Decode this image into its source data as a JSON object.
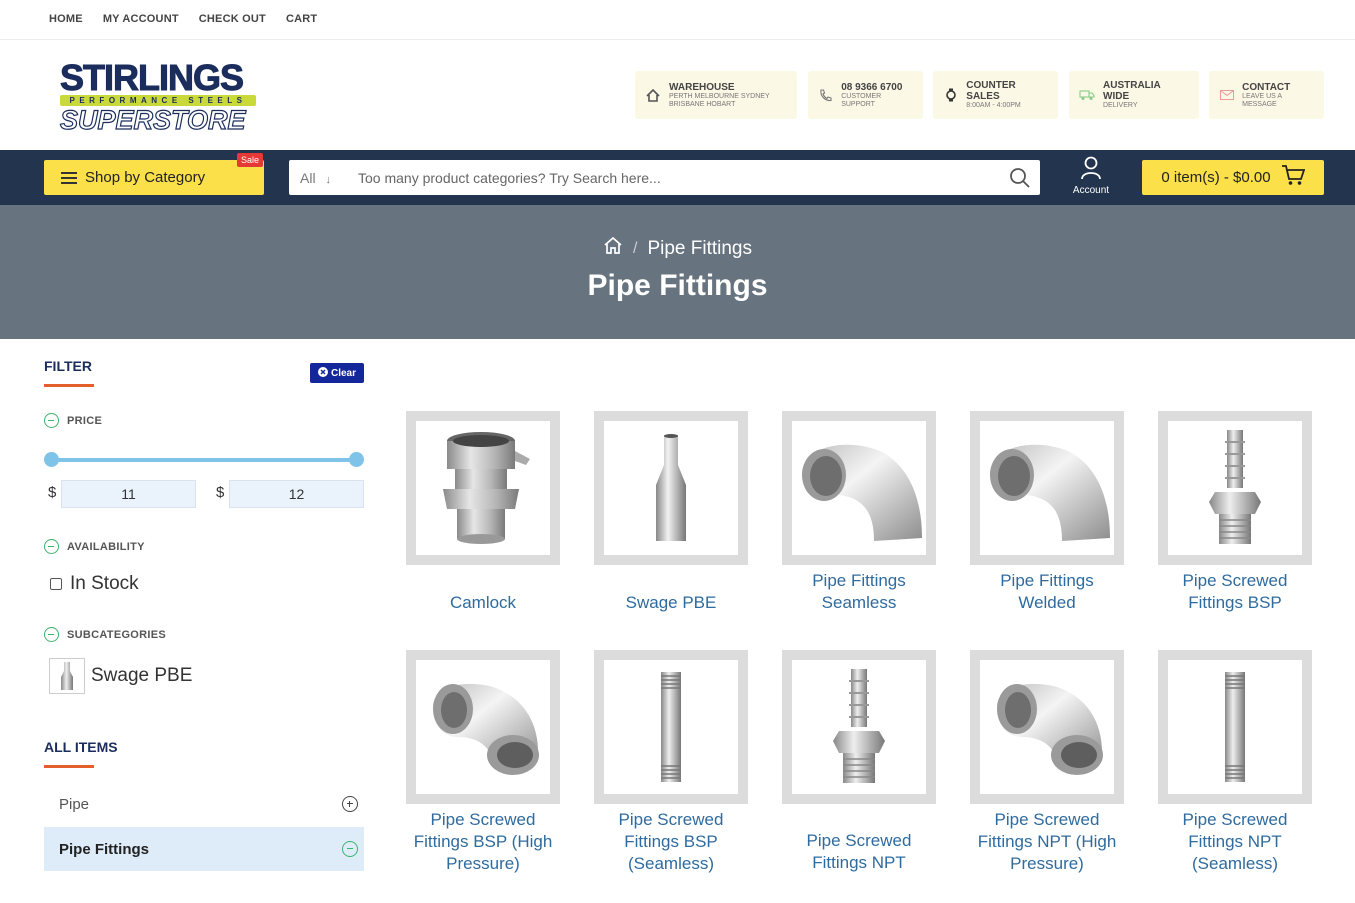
{
  "topnav": [
    "HOME",
    "MY ACCOUNT",
    "CHECK OUT",
    "CART"
  ],
  "logo": {
    "line1": "STIRLINGS",
    "line2": "PERFORMANCE STEELS",
    "line3": "SUPERSTORE"
  },
  "info": [
    {
      "title": "WAREHOUSE",
      "sub1": "PERTH MELBOURNE SYDNEY",
      "sub2": "BRISBANE HOBART",
      "icon": "home-icon"
    },
    {
      "title": "08 9366 6700",
      "sub1": "CUSTOMER SUPPORT",
      "sub2": "",
      "icon": "phone-icon"
    },
    {
      "title": "COUNTER SALES",
      "sub1": "8:00AM - 4:00PM",
      "sub2": "",
      "icon": "clock-icon"
    },
    {
      "title": "AUSTRALIA WIDE",
      "sub1": "DELIVERY",
      "sub2": "",
      "icon": "truck-icon"
    },
    {
      "title": "CONTACT",
      "sub1": "LEAVE US A MESSAGE",
      "sub2": "",
      "icon": "mail-icon"
    }
  ],
  "nav": {
    "shop_label": "Shop by Category",
    "sale_badge": "Sale",
    "search_scope": "All",
    "search_placeholder": "Too many product categories? Try Search here...",
    "account_label": "Account",
    "cart_label": "0 item(s) - $0.00"
  },
  "banner": {
    "crumb": "Pipe Fittings",
    "title": "Pipe Fittings"
  },
  "sidebar": {
    "filter_title": "FILTER",
    "clear_label": "Clear",
    "price_label": "PRICE",
    "price_min": "11",
    "price_max": "12",
    "currency": "$",
    "availability_label": "AVAILABILITY",
    "in_stock_label": "In Stock",
    "subcategories_label": "SUBCATEGORIES",
    "subcategory_item": "Swage PBE",
    "all_items_title": "ALL ITEMS",
    "all_items": [
      {
        "label": "Pipe",
        "active": false
      },
      {
        "label": "Pipe Fittings",
        "active": true
      }
    ]
  },
  "products": [
    {
      "name": "Camlock",
      "shape": "camlock"
    },
    {
      "name": "Swage PBE",
      "shape": "swage"
    },
    {
      "name": "Pipe Fittings Seamless",
      "shape": "elbow"
    },
    {
      "name": "Pipe Fittings Welded",
      "shape": "elbow"
    },
    {
      "name": "Pipe Screwed Fittings BSP",
      "shape": "hosetail"
    },
    {
      "name": "Pipe Screwed Fittings BSP (High Pressure)",
      "shape": "threaded-elbow"
    },
    {
      "name": "Pipe Screwed Fittings BSP (Seamless)",
      "shape": "nipple"
    },
    {
      "name": "Pipe Screwed Fittings NPT",
      "shape": "hosetail"
    },
    {
      "name": "Pipe Screwed Fittings NPT (High Pressure)",
      "shape": "threaded-elbow"
    },
    {
      "name": "Pipe Screwed Fittings NPT (Seamless)",
      "shape": "nipple"
    }
  ],
  "colors": {
    "navy": "#23344f",
    "yellow": "#fbe04a",
    "banner": "#67737e",
    "link": "#2f6b9e",
    "accent": "#e4602b"
  }
}
